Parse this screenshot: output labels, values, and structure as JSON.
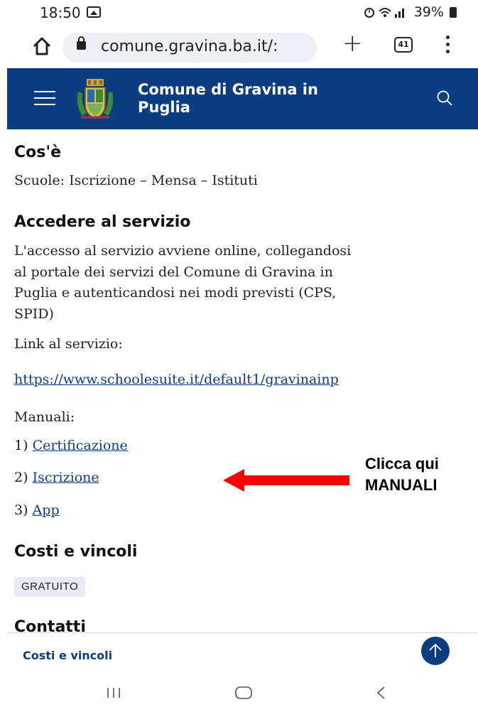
{
  "status_bar": {
    "time": "18:50",
    "battery": "39%"
  },
  "browser": {
    "url": "comune.gravina.ba.it/:",
    "tab_count": "41"
  },
  "site_header": {
    "title_line1": "Comune di Gravina in",
    "title_line2": "Puglia"
  },
  "sections": {
    "cos_e": {
      "heading": "Cos'è",
      "text": "Scuole: Iscrizione – Mensa – Istituti"
    },
    "accedere": {
      "heading": "Accedere al servizio",
      "paragraph_lines": [
        "L'accesso al servizio avviene online, collegandosi",
        "al portale dei servizi del Comune di Gravina in",
        "Puglia e autenticandosi nei modi previsti (CPS,",
        "SPID)"
      ],
      "link_label": "Link al servizio:",
      "service_link": "https://www.schoolesuite.it/default1/gravinainp",
      "manuals_label": "Manuali:",
      "manuals": [
        {
          "num": "1)",
          "label": "Certificazione"
        },
        {
          "num": "2)",
          "label": "Iscrizione"
        },
        {
          "num": "3)",
          "label": "App"
        }
      ]
    },
    "costi": {
      "heading": "Costi e vincoli",
      "badge": "GRATUITO"
    },
    "contatti": {
      "heading": "Contatti"
    }
  },
  "annotation": {
    "line1": "Clicca qui",
    "line2": "MANUALI",
    "color": "#ff0000"
  },
  "sticky_nav": {
    "label": "Costi e vincoli"
  },
  "colors": {
    "brand": "#0b3d80",
    "badge_bg": "#e8ebf2"
  },
  "icons": [
    "home-icon",
    "lock-icon",
    "plus-icon",
    "tabs-icon",
    "more-icon",
    "hamburger-icon",
    "search-icon",
    "arrow-up-icon",
    "recents-icon",
    "home-nav-icon",
    "back-icon"
  ]
}
